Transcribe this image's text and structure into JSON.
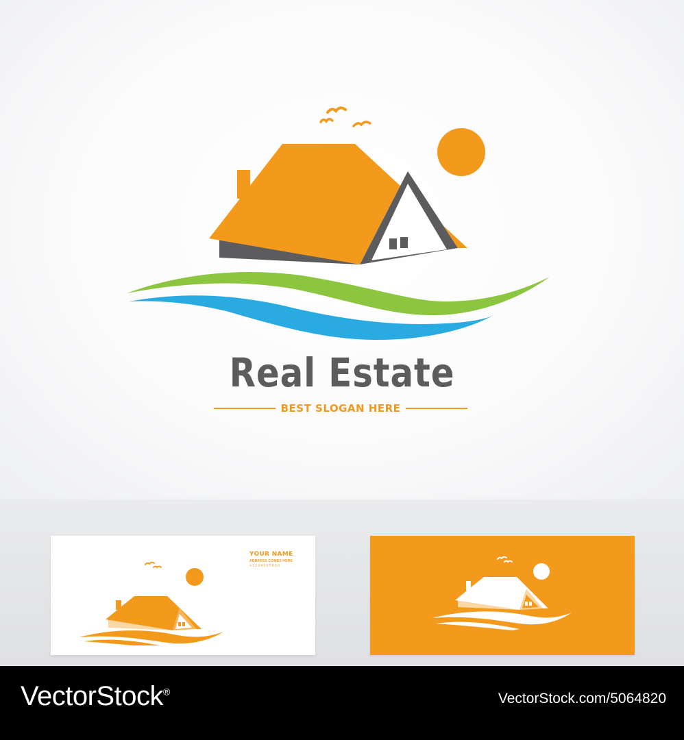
{
  "logo": {
    "title": "Real Estate",
    "slogan": "BEST SLOGAN HERE"
  },
  "business_card": {
    "name": "YOUR NAME",
    "address": "ADDRESS COMES HERE",
    "phone": "+1234567810"
  },
  "watermark": {
    "brand_prefix": "Vector",
    "brand_suffix": "Stock",
    "trademark": "®",
    "site_id": "VectorStock.com/5064820"
  },
  "colors": {
    "orange": "#f39a1d",
    "gray": "#5c5c5e",
    "green": "#8cc53f",
    "blue": "#29abe2",
    "footer": "#000000"
  },
  "icons": [
    "house-icon",
    "sun-icon",
    "birds-icon",
    "wave-icon"
  ]
}
